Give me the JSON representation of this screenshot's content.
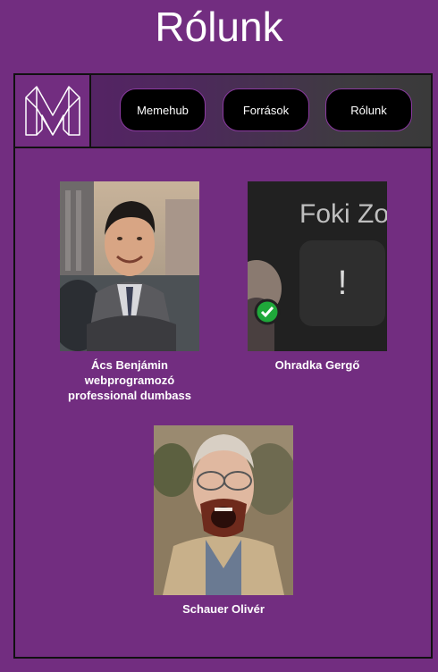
{
  "page": {
    "title": "Rólunk"
  },
  "nav": {
    "logo_icon": "memehub-m-logo-icon",
    "items": [
      {
        "label": "Memehub"
      },
      {
        "label": "Források"
      },
      {
        "label": "Rólunk"
      }
    ]
  },
  "team": [
    {
      "name": "Ács Benjámin",
      "line2": "webprogramozó",
      "line3": "professional dumbass",
      "photo": "member-photo-1"
    },
    {
      "name": "Ohradka Gergő",
      "photo": "member-photo-2",
      "photo_text": "Foki Zo",
      "photo_badge": "!"
    },
    {
      "name": "Schauer Olivér",
      "photo": "member-photo-3"
    }
  ],
  "colors": {
    "background": "#722d80",
    "button_bg": "#000000",
    "button_border": "#8a39a0"
  }
}
